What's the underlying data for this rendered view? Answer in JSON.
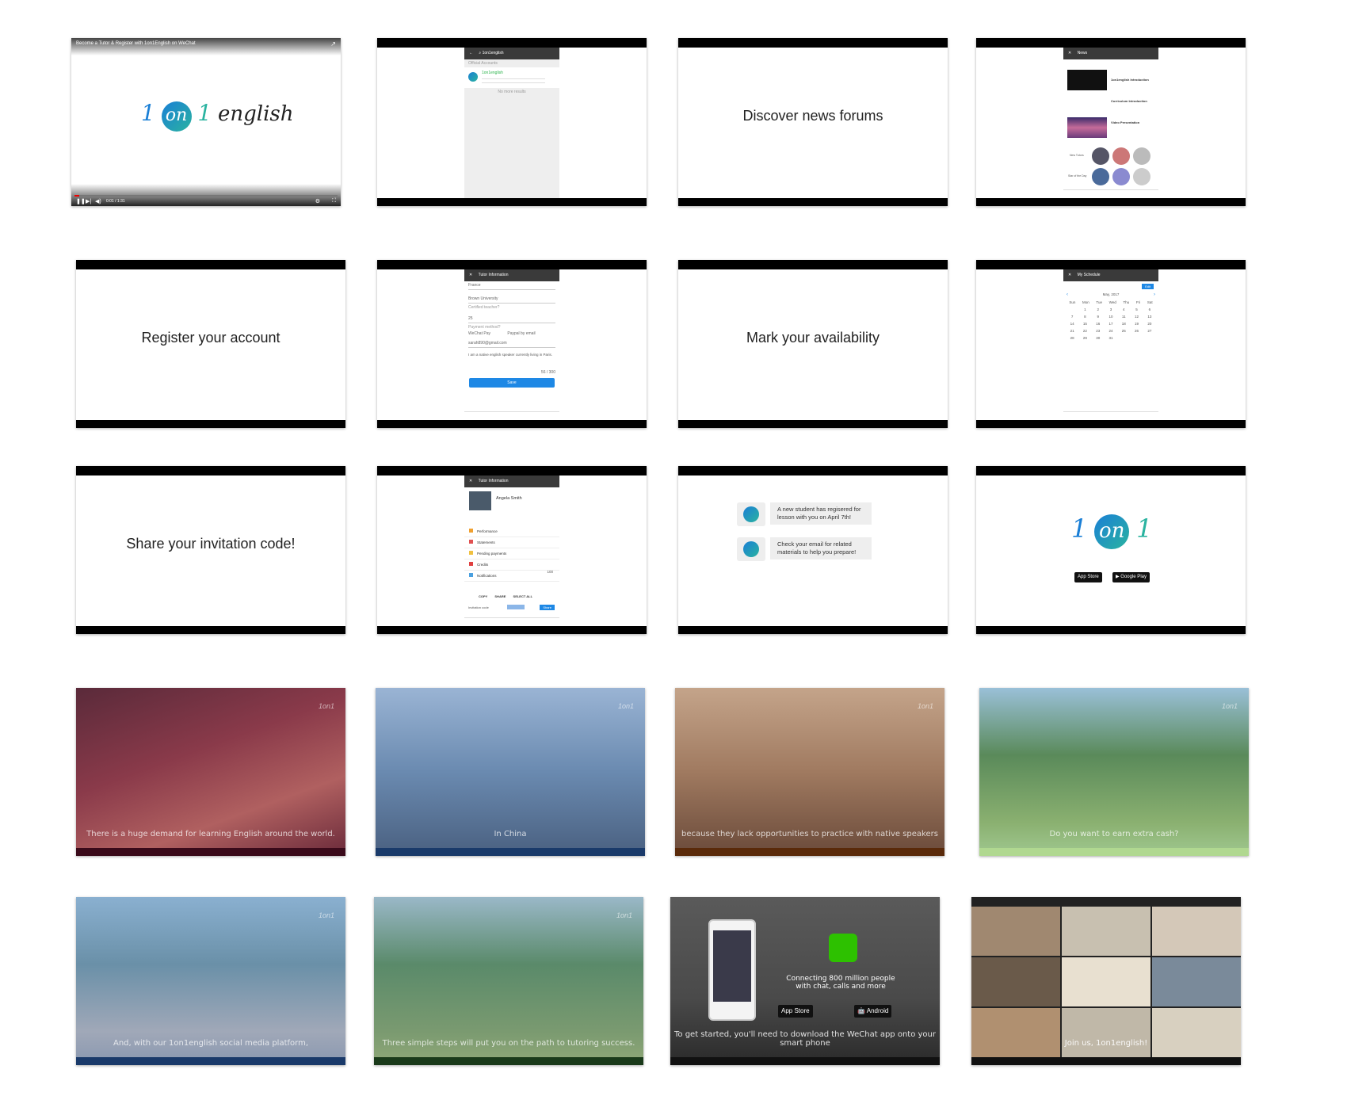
{
  "frames": {
    "f1": {
      "video_title": "Become a Tutor & Register with 1on1English on WeChat",
      "logo_a": "1",
      "logo_on": "on",
      "logo_b": "1",
      "logo_word": "english",
      "time": "0:01 / 1:31"
    },
    "f2": {
      "search_query": "1on1english",
      "section": "Official Accounts",
      "result_name": "1on1english",
      "no_more": "No more results"
    },
    "f3": {
      "caption": "Discover news forums"
    },
    "f4": {
      "title": "News",
      "item1": "1on1english Introduction",
      "item2": "Curriculum Introduction",
      "item3": "Video Presentation",
      "label_tutors": "New Tutors",
      "label_star": "Star of the Day"
    },
    "f5": {
      "caption": "Register your account"
    },
    "f6": {
      "title": "Tutor Information",
      "country": "France",
      "university": "Brown University",
      "certified": "Certified teacher?",
      "rate": "25",
      "payment": "Payment method?",
      "opt_wechat": "WeChat Pay",
      "opt_paypal": "Paypal by email",
      "email": "sarah890@gmail.com",
      "bio": "I am a native english speaker currently living in Paris.",
      "count": "56 / 300",
      "save": "Save"
    },
    "f7": {
      "caption": "Mark your availability"
    },
    "f8": {
      "title": "My Schedule",
      "edit": "Edit",
      "month": "May, 2017",
      "days": [
        "Sun",
        "Mon",
        "Tue",
        "Wed",
        "Thu",
        "Fri",
        "Sat"
      ],
      "weeks": [
        [
          "",
          "1",
          "2",
          "3",
          "4",
          "5",
          "6"
        ],
        [
          "7",
          "8",
          "9",
          "10",
          "11",
          "12",
          "13"
        ],
        [
          "14",
          "15",
          "16",
          "17",
          "18",
          "19",
          "20"
        ],
        [
          "21",
          "22",
          "23",
          "24",
          "25",
          "26",
          "27"
        ],
        [
          "28",
          "29",
          "30",
          "31",
          "",
          "",
          ""
        ]
      ]
    },
    "f9": {
      "caption": "Share your invitation code!"
    },
    "f10": {
      "title": "Tutor Information",
      "name": "Angela Smith",
      "menu": [
        "Performance",
        "Statements",
        "Pending payments",
        "Credits",
        "Notifications"
      ],
      "credits": "100",
      "copy": "COPY",
      "share": "SHARE",
      "select_all": "SELECT ALL",
      "invitation_label": "Invitation code",
      "share_btn": "Share"
    },
    "f11": {
      "msg1": "A new student has regisered for lesson with you on April 7th!",
      "msg2": "Check your email for related materials to help you prepare!"
    },
    "f12": {
      "logo_a": "1",
      "logo_on": "on",
      "logo_b": "1",
      "appstore_small": "Download on the",
      "appstore": "App Store",
      "gplay_small": "GET IT ON",
      "gplay": "Google Play"
    },
    "f13": {
      "subtitle": "There is a huge demand for learning English around the world."
    },
    "f14": {
      "subtitle": "In China"
    },
    "f15": {
      "subtitle": "because they lack opportunities to practice with native speakers"
    },
    "f16": {
      "subtitle": "Do you want to earn extra cash?"
    },
    "f17": {
      "subtitle": "And, with our 1on1english social media platform,"
    },
    "f18": {
      "subtitle": "Three simple steps will put you on the path to tutoring success."
    },
    "f19": {
      "headline": "Connecting 800 million people with chat, calls and more",
      "appstore_small": "Download on the",
      "appstore": "App Store",
      "android_small": "Download for",
      "android": "Android",
      "subtitle": "To get started, you'll need to download the WeChat app onto your smart phone"
    },
    "f20": {
      "subtitle": "Join us, 1on1english!"
    }
  },
  "colors": {
    "brand_blue": "#1a7fd6",
    "brand_teal": "#2ab3a0",
    "save_blue": "#1e88e5"
  }
}
